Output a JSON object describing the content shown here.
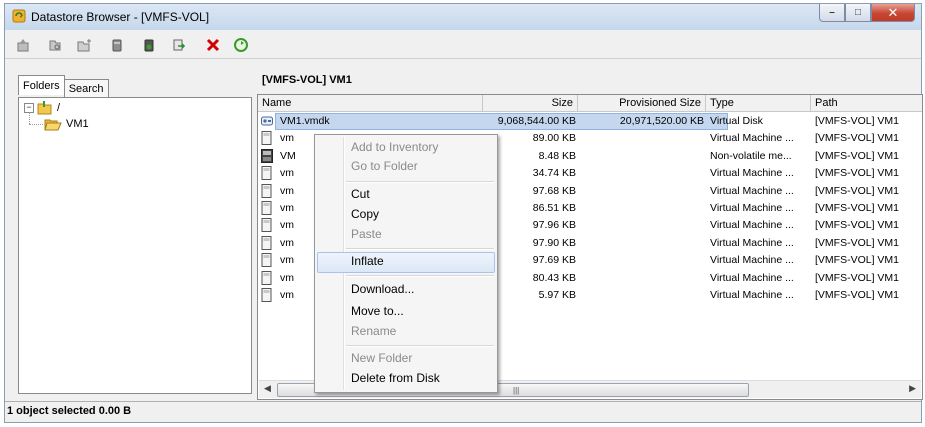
{
  "window": {
    "title": "Datastore Browser - [VMFS-VOL]",
    "controls": {
      "minimize": "–",
      "maximize": "□",
      "close": "✕"
    }
  },
  "toolbar": {
    "icons": [
      "folder-up-icon",
      "browse-icon",
      "new-folder-icon",
      "upload-icon",
      "download-icon",
      "move-icon",
      "delete-icon",
      "refresh-icon"
    ]
  },
  "left_pane": {
    "tabs": [
      "Folders",
      "Search"
    ],
    "tree": {
      "root_label": "/",
      "root_expander": "−",
      "child_label": "VM1"
    }
  },
  "right_pane": {
    "header": "[VMFS-VOL] VM1",
    "columns": {
      "name": "Name",
      "size": "Size",
      "provisioned": "Provisioned Size",
      "type": "Type",
      "path": "Path"
    },
    "rows": [
      {
        "name": "VM1.vmdk",
        "size": "9,068,544.00 KB",
        "provisioned": "20,971,520.00 KB",
        "type": "Virtual Disk",
        "path": "[VMFS-VOL] VM1",
        "icon": "virtual-disk-icon"
      },
      {
        "name": "vm",
        "size": "89.00 KB",
        "provisioned": "",
        "type": "Virtual Machine ...",
        "path": "[VMFS-VOL] VM1",
        "icon": "file-icon"
      },
      {
        "name": "VM",
        "size": "8.48 KB",
        "provisioned": "",
        "type": "Non-volatile me...",
        "path": "[VMFS-VOL] VM1",
        "icon": "nvram-icon"
      },
      {
        "name": "vm",
        "size": "34.74 KB",
        "provisioned": "",
        "type": "Virtual Machine ...",
        "path": "[VMFS-VOL] VM1",
        "icon": "file-icon"
      },
      {
        "name": "vm",
        "size": "97.68 KB",
        "provisioned": "",
        "type": "Virtual Machine ...",
        "path": "[VMFS-VOL] VM1",
        "icon": "file-icon"
      },
      {
        "name": "vm",
        "size": "86.51 KB",
        "provisioned": "",
        "type": "Virtual Machine ...",
        "path": "[VMFS-VOL] VM1",
        "icon": "file-icon"
      },
      {
        "name": "vm",
        "size": "97.96 KB",
        "provisioned": "",
        "type": "Virtual Machine ...",
        "path": "[VMFS-VOL] VM1",
        "icon": "file-icon"
      },
      {
        "name": "vm",
        "size": "97.90 KB",
        "provisioned": "",
        "type": "Virtual Machine ...",
        "path": "[VMFS-VOL] VM1",
        "icon": "file-icon"
      },
      {
        "name": "vm",
        "size": "97.69 KB",
        "provisioned": "",
        "type": "Virtual Machine ...",
        "path": "[VMFS-VOL] VM1",
        "icon": "file-icon"
      },
      {
        "name": "vm",
        "size": "80.43 KB",
        "provisioned": "",
        "type": "Virtual Machine ...",
        "path": "[VMFS-VOL] VM1",
        "icon": "file-icon"
      },
      {
        "name": "vm",
        "size": "5.97 KB",
        "provisioned": "",
        "type": "Virtual Machine ...",
        "path": "[VMFS-VOL] VM1",
        "icon": "file-icon"
      }
    ],
    "selected_index": 0
  },
  "context_menu": {
    "items": [
      {
        "label": "Add to Inventory",
        "enabled": false
      },
      {
        "label": "Go to Folder",
        "enabled": false
      },
      {
        "label": "Cut",
        "enabled": true
      },
      {
        "label": "Copy",
        "enabled": true
      },
      {
        "label": "Paste",
        "enabled": false
      },
      {
        "label": "Inflate",
        "enabled": true,
        "highlighted": true
      },
      {
        "label": "Download...",
        "enabled": true
      },
      {
        "label": "Move to...",
        "enabled": true
      },
      {
        "label": "Rename",
        "enabled": false
      },
      {
        "label": "New Folder",
        "enabled": false
      },
      {
        "label": "Delete from Disk",
        "enabled": true
      }
    ]
  },
  "status": {
    "text": "1 object selected 0.00 B"
  },
  "colors": {
    "selection": "#c4d7ee",
    "delete_red": "#d40000",
    "refresh_green": "#3a9a2a",
    "folder_yellow": "#f2c94c"
  }
}
